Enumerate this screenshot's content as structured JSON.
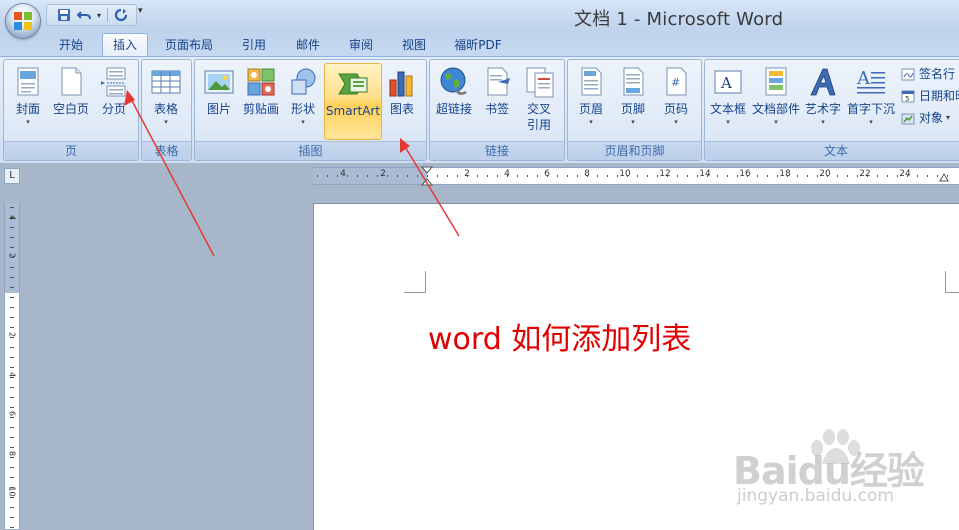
{
  "app": {
    "title": "文档 1 - Microsoft Word",
    "ribbon_tabs": [
      "开始",
      "插入",
      "页面布局",
      "引用",
      "邮件",
      "审阅",
      "视图",
      "福昕PDF"
    ],
    "active_tab": "插入"
  },
  "ribbon": {
    "groups": {
      "page": {
        "label": "页",
        "buttons": [
          "封面",
          "空白页",
          "分页"
        ]
      },
      "table": {
        "label": "表格",
        "buttons": [
          "表格"
        ]
      },
      "illustrations": {
        "label": "插图",
        "buttons": [
          "图片",
          "剪贴画",
          "形状",
          "SmartArt",
          "图表"
        ]
      },
      "links": {
        "label": "链接",
        "buttons": [
          "超链接",
          "书签",
          "交叉",
          "引用"
        ]
      },
      "header_footer": {
        "label": "页眉和页脚",
        "buttons": [
          "页眉",
          "页脚",
          "页码"
        ]
      },
      "text": {
        "label": "文本",
        "buttons": [
          "文本框",
          "文档部件",
          "艺术字",
          "首字下沉"
        ],
        "small_buttons": [
          "签名行",
          "日期和时",
          "对象"
        ]
      }
    }
  },
  "ruler": {
    "h_numbers": [
      "4",
      "2",
      "2",
      "4",
      "6",
      "8",
      "10",
      "12",
      "14",
      "16",
      "18",
      "20",
      "22",
      "24"
    ],
    "v_numbers": [
      "4",
      "2",
      "2",
      "4",
      "6",
      "8",
      "10"
    ]
  },
  "document": {
    "text": "word 如何添加列表"
  },
  "watermark": {
    "main": "Baidu经验",
    "sub": "jingyan.baidu.com"
  },
  "colors": {
    "annotation_arrow": "#e53935",
    "doc_text": "#e00000",
    "highlight": "#ffd05a"
  }
}
